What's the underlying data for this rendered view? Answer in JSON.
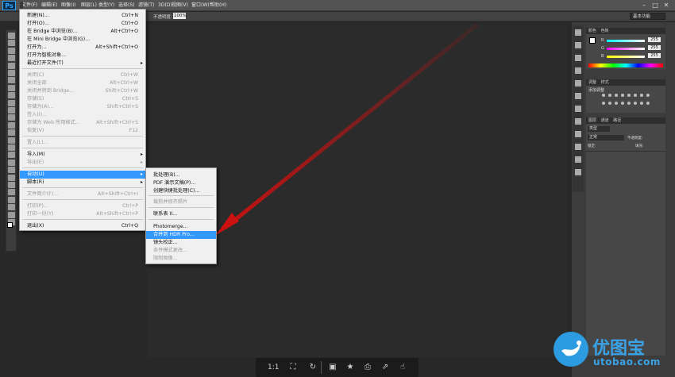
{
  "menubar": {
    "logo": "Ps",
    "items": [
      "文件(F)",
      "编辑(E)",
      "图像(I)",
      "图层(L)",
      "类型(Y)",
      "选择(S)",
      "滤镜(T)",
      "3D(D)",
      "视图(V)",
      "窗口(W)",
      "帮助(H)"
    ],
    "workspace": "基本功能"
  },
  "optbar": {
    "opacity_label": "不透明度:",
    "opacity_value": "100%"
  },
  "file_menu": {
    "items": [
      {
        "label": "新建(N)...",
        "shortcut": "Ctrl+N"
      },
      {
        "label": "打开(O)...",
        "shortcut": "Ctrl+O"
      },
      {
        "label": "在 Bridge 中浏览(B)...",
        "shortcut": "Alt+Ctrl+O"
      },
      {
        "label": "在 Mini Bridge 中浏览(G)...",
        "shortcut": ""
      },
      {
        "label": "打开为...",
        "shortcut": "Alt+Shift+Ctrl+O"
      },
      {
        "label": "打开为智能对象...",
        "shortcut": ""
      },
      {
        "label": "最近打开文件(T)",
        "shortcut": ""
      },
      {
        "label": "关闭(C)",
        "shortcut": "Ctrl+W"
      },
      {
        "label": "关闭全部",
        "shortcut": "Alt+Ctrl+W"
      },
      {
        "label": "关闭并转到 Bridge...",
        "shortcut": "Shift+Ctrl+W"
      },
      {
        "label": "存储(S)",
        "shortcut": "Ctrl+S"
      },
      {
        "label": "存储为(A)...",
        "shortcut": "Shift+Ctrl+S"
      },
      {
        "label": "签入(I)...",
        "shortcut": ""
      },
      {
        "label": "存储为 Web 所用格式...",
        "shortcut": "Alt+Shift+Ctrl+S"
      },
      {
        "label": "恢复(V)",
        "shortcut": "F12"
      },
      {
        "label": "置入(L)...",
        "shortcut": ""
      },
      {
        "label": "导入(M)",
        "shortcut": ""
      },
      {
        "label": "导出(E)",
        "shortcut": ""
      },
      {
        "label": "自动(U)",
        "shortcut": ""
      },
      {
        "label": "脚本(R)",
        "shortcut": ""
      },
      {
        "label": "文件简介(F)...",
        "shortcut": "Alt+Shift+Ctrl+I"
      },
      {
        "label": "打印(P)...",
        "shortcut": "Ctrl+P"
      },
      {
        "label": "打印一份(Y)",
        "shortcut": "Alt+Shift+Ctrl+P"
      },
      {
        "label": "退出(X)",
        "shortcut": "Ctrl+Q"
      }
    ]
  },
  "auto_submenu": {
    "items": [
      "批处理(B)...",
      "PDF 演示文稿(P)...",
      "创建快捷批处理(C)...",
      "裁剪并修齐照片",
      "联系表 II...",
      "Photomerge...",
      "合并到 HDR Pro...",
      "镜头校正...",
      "条件模式更改...",
      "限制图像..."
    ]
  },
  "right_panel": {
    "color_tabs": [
      "颜色",
      "色板"
    ],
    "rgb": [
      {
        "label": "R",
        "value": "255"
      },
      {
        "label": "G",
        "value": "255"
      },
      {
        "label": "B",
        "value": "255"
      }
    ],
    "adjust_tabs": [
      "调整",
      "样式"
    ],
    "adjust_title": "添加调整",
    "layer_tabs": [
      "图层",
      "通道",
      "路径"
    ],
    "layer_kind": "类型",
    "blend_mode": "正常",
    "opacity_label": "不透明度:",
    "lock_label": "锁定:",
    "fill_label": "填充:"
  },
  "bottombar": {
    "zoom_label": "1:1"
  },
  "watermark": {
    "brand": "优图宝",
    "url": "utobao.com"
  },
  "colors": {
    "highlight": "#3399ff",
    "arrow": "#cc1111",
    "watermark": "#3aa2e6"
  }
}
